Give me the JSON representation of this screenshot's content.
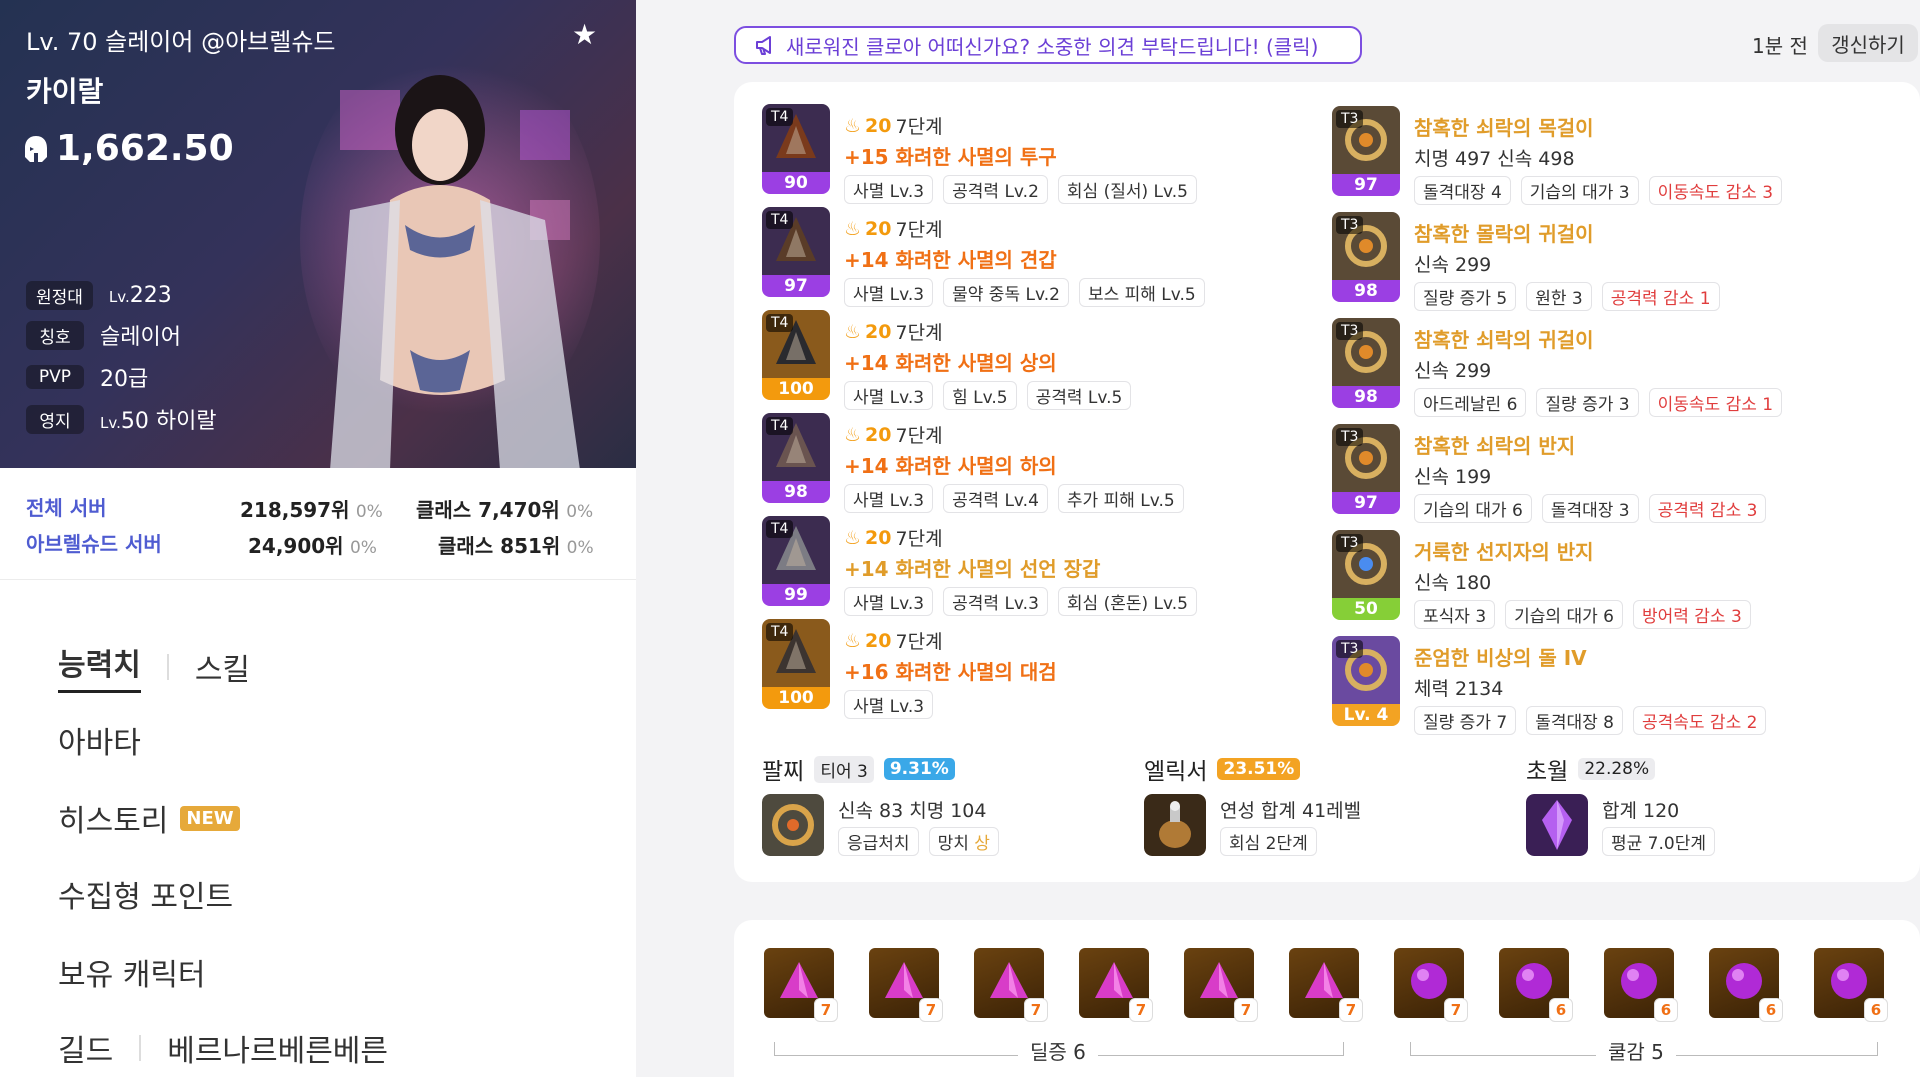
{
  "header": {
    "level_server": "Lv. 70 슬레이어 @아브렐슈드",
    "name": "카이랄",
    "item_level": "1,662.50",
    "tags": [
      {
        "key": "원정대",
        "prefix": "Lv.",
        "value": "223"
      },
      {
        "key": "칭호",
        "prefix": "",
        "value": "슬레이어"
      },
      {
        "key": "PVP",
        "prefix": "",
        "value": "20급"
      },
      {
        "key": "영지",
        "prefix": "Lv.",
        "value": "50 하이랄"
      }
    ]
  },
  "rank": {
    "all_label": "전체 서버",
    "server_label": "아브렐슈드 서버",
    "all_rank": "218,597위",
    "all_pct": "0%",
    "all_class": "클래스 7,470위",
    "all_class_pct": "0%",
    "srv_rank": "24,900위",
    "srv_pct": "0%",
    "srv_class": "클래스 851위",
    "srv_class_pct": "0%"
  },
  "menu": {
    "tab1": "능력치",
    "tab2": "스킬",
    "avatar": "아바타",
    "history": "히스토리",
    "history_badge": "NEW",
    "collect": "수집형 포인트",
    "chars": "보유 캐릭터",
    "guild": "길드",
    "guild_name": "베르나르베른베른"
  },
  "banner": "새로워진 클로아 어떠신가요? 소중한 의견 부탁드립니다! (클릭)",
  "time_ago": "1분 전",
  "refresh": "갱신하기",
  "armor": [
    {
      "tier": "T4",
      "q": "90",
      "upgrade": "20",
      "stage": "7단계",
      "name": "+15 화려한 사멸의 투구",
      "chips": [
        "사멸 Lv.3",
        "공격력 Lv.2",
        "회심 (질서) Lv.5"
      ]
    },
    {
      "tier": "T4",
      "q": "97",
      "upgrade": "20",
      "stage": "7단계",
      "name": "+14 화려한 사멸의 견갑",
      "chips": [
        "사멸 Lv.3",
        "물약 중독 Lv.2",
        "보스 피해 Lv.5"
      ]
    },
    {
      "tier": "T4",
      "q": "100",
      "upgrade": "20",
      "stage": "7단계",
      "name": "+14 화려한 사멸의 상의",
      "chips": [
        "사멸 Lv.3",
        "힘 Lv.5",
        "공격력 Lv.5"
      ]
    },
    {
      "tier": "T4",
      "q": "98",
      "upgrade": "20",
      "stage": "7단계",
      "name": "+14 화려한 사멸의 하의",
      "chips": [
        "사멸 Lv.3",
        "공격력 Lv.4",
        "추가 피해 Lv.5"
      ]
    },
    {
      "tier": "T4",
      "q": "99",
      "upgrade": "20",
      "stage": "7단계",
      "name": "+14 화려한 사멸의 선언 장갑",
      "chips": [
        "사멸 Lv.3",
        "공격력 Lv.3",
        "회심 (혼돈) Lv.5"
      ]
    },
    {
      "tier": "T4",
      "q": "100",
      "upgrade": "20",
      "stage": "7단계",
      "name": "+16 화려한 사멸의 대검",
      "chips": [
        "사멸 Lv.3"
      ]
    }
  ],
  "accessories": [
    {
      "tier": "T3",
      "q": "97",
      "name": "참혹한 쇠락의 목걸이",
      "stats": "치명 497  신속 498",
      "chips": [
        "돌격대장 4",
        "기습의 대가 3"
      ],
      "neg": "이동속도 감소 3"
    },
    {
      "tier": "T3",
      "q": "98",
      "name": "참혹한 몰락의 귀걸이",
      "stats": "신속 299",
      "chips": [
        "질량 증가 5",
        "원한 3"
      ],
      "neg": "공격력 감소 1"
    },
    {
      "tier": "T3",
      "q": "98",
      "name": "참혹한 쇠락의 귀걸이",
      "stats": "신속 299",
      "chips": [
        "아드레날린 6",
        "질량 증가 3"
      ],
      "neg": "이동속도 감소 1"
    },
    {
      "tier": "T3",
      "q": "97",
      "name": "참혹한 쇠락의 반지",
      "stats": "신속 199",
      "chips": [
        "기습의 대가 6",
        "돌격대장 3"
      ],
      "neg": "공격력 감소 3"
    },
    {
      "tier": "T3",
      "q": "50",
      "name": "거룩한 선지자의 반지",
      "stats": "신속 180",
      "chips": [
        "포식자 3",
        "기습의 대가 6"
      ],
      "neg": "방어력 감소 3"
    },
    {
      "tier": "T3",
      "q": "Lv. 4",
      "name": "준엄한 비상의 돌 IV",
      "stats": "체력 2134",
      "chips": [
        "질량 증가 7",
        "돌격대장 8"
      ],
      "neg": "공격속도 감소 2"
    }
  ],
  "bracelet": {
    "title": "팔찌",
    "tier": "티어 3",
    "pct": "9.31%",
    "stats": "신속 83  치명 104",
    "chip1": "응급처치",
    "chip2": "망치",
    "chip2_grade": "상"
  },
  "elixir": {
    "title": "엘릭서",
    "pct": "23.51%",
    "stats": "연성 합계 41레벨",
    "chip": "회심 2단계"
  },
  "transcend": {
    "title": "초월",
    "pct": "22.28%",
    "stats": "합계 120",
    "chip": "평균 7.0단계"
  },
  "gems": {
    "levels": [
      "7",
      "7",
      "7",
      "7",
      "7",
      "7",
      "7",
      "6",
      "6",
      "6",
      "6"
    ],
    "group1": "딜증 6",
    "group2": "쿨감 5"
  },
  "colors": {
    "accent_purple": "#7c4ee0",
    "orange": "#f07015",
    "gold": "#e09c2a",
    "red": "#e03d3d"
  }
}
